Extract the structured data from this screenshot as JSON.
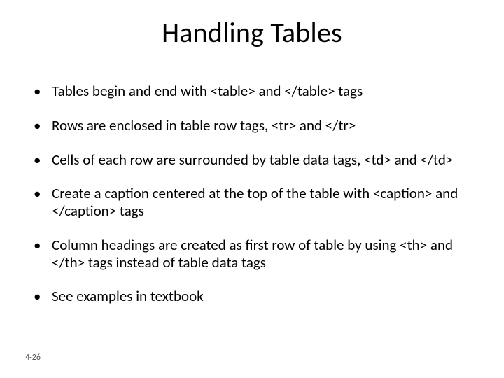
{
  "title": "Handling Tables",
  "bullets": [
    "Tables begin and end with <table> and </table> tags",
    "Rows are enclosed in table row tags, <tr> and </tr>",
    "Cells of each row are surrounded by table data tags, <td> and </td>",
    "Create a caption centered at the top of the table with <caption> and </caption> tags",
    "Column headings are created as first row of table by using <th> and </th> tags instead of table data tags",
    "See examples in textbook"
  ],
  "footer": "4-26"
}
